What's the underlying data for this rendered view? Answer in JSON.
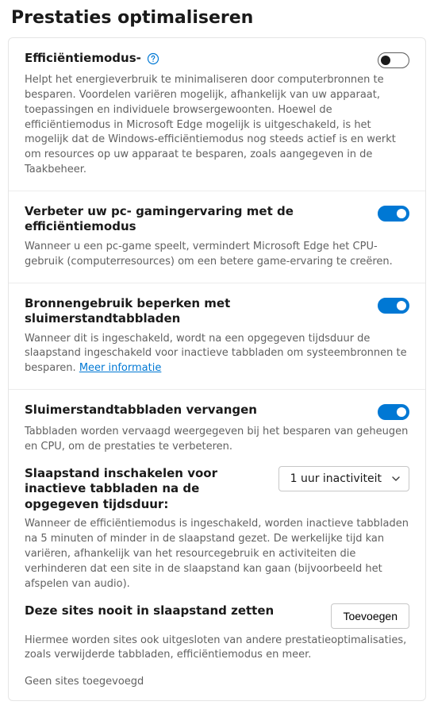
{
  "page_title": "Prestaties optimaliseren",
  "efficiency": {
    "title": "Efficiëntiemodus-",
    "description": "Helpt het energieverbruik te minimaliseren door computerbronnen te besparen. Voordelen variëren mogelijk, afhankelijk van uw apparaat, toepassingen en individuele browsergewoonten. Hoewel de efficiëntiemodus in Microsoft Edge mogelijk is uitgeschakeld, is het mogelijk dat de Windows-efficiëntiemodus nog steeds actief is en werkt om resources op uw apparaat te besparen, zoals aangegeven in de Taakbeheer.",
    "enabled": false
  },
  "gaming": {
    "title": "Verbeter uw pc- gamingervaring met de efficiëntiemodus",
    "description": "Wanneer u een pc-game speelt, vermindert Microsoft Edge het CPU-gebruik (computerresources) om een betere game-ervaring te creëren.",
    "enabled": true
  },
  "sleeping_tabs": {
    "title": "Bronnengebruik beperken met sluimerstandtabbladen",
    "description": "Wanneer dit is ingeschakeld, wordt na een opgegeven tijdsduur de slaapstand ingeschakeld voor inactieve tabbladen om systeembronnen te besparen. ",
    "link_text": "Meer informatie",
    "enabled": true
  },
  "fade": {
    "title": "Sluimerstandtabbladen vervangen",
    "description": "Tabbladen worden vervaagd weergegeven bij het besparen van geheugen en CPU, om de prestaties te verbeteren.",
    "enabled": true
  },
  "sleep_after": {
    "title": "Slaapstand inschakelen voor inactieve tabbladen na de opgegeven tijdsduur:",
    "selected": "1 uur inactiviteit",
    "description": "Wanneer de efficiëntiemodus is ingeschakeld, worden inactieve tabbladen na 5 minuten of minder in de slaapstand gezet. De werkelijke tijd kan variëren, afhankelijk van het resourcegebruik en activiteiten die verhinderen dat een site in de slaapstand kan gaan (bijvoorbeeld het afspelen van audio)."
  },
  "never_sleep": {
    "title": "Deze sites nooit in slaapstand zetten",
    "button": "Toevoegen",
    "description": "Hiermee worden sites ook uitgesloten van andere prestatieoptimalisaties, zoals verwijderde tabbladen, efficiëntiemodus en meer.",
    "empty": "Geen sites toegevoegd"
  }
}
